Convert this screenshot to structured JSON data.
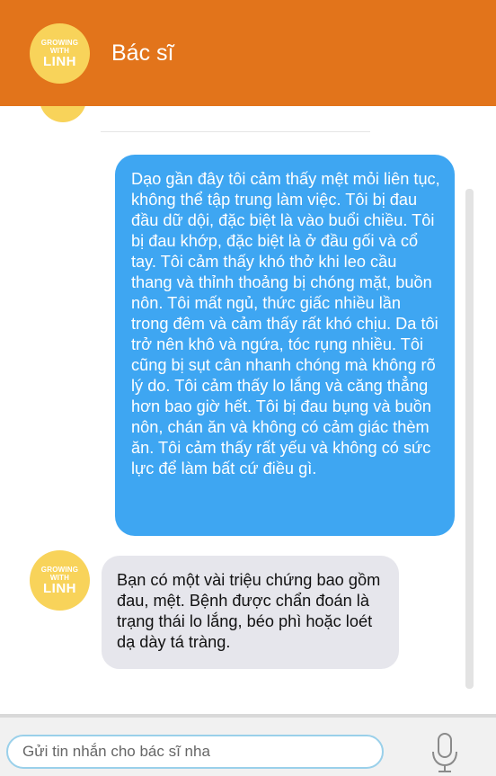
{
  "header": {
    "title": "Bác sĩ",
    "background_color": "#e2741b",
    "avatar": {
      "line1": "GROWING",
      "line2": "WITH",
      "line3": "LINH",
      "color": "#f8d35a"
    }
  },
  "messages": [
    {
      "sender": "user",
      "text": "Dạo gần đây tôi cảm thấy mệt mỏi liên tục, không thể tập trung làm việc. Tôi bị đau đầu dữ dội, đặc biệt là vào buổi chiều. Tôi bị đau khớp, đặc biệt là ở đầu gối và cổ tay. Tôi cảm thấy khó thở khi leo cầu thang và thỉnh thoảng bị chóng mặt, buồn nôn. Tôi mất ngủ, thức giấc nhiều lần trong đêm và cảm thấy rất khó chịu. Da tôi trở nên khô và ngứa, tóc rụng nhiều. Tôi cũng bị sụt cân nhanh chóng mà không rõ lý do. Tôi cảm thấy lo lắng và căng thẳng hơn bao giờ hết. Tôi bị đau bụng và buồn nôn, chán ăn và không có cảm giác thèm ăn. Tôi cảm thấy rất yếu và không có sức lực để làm bất cứ điều gì.",
      "bubble_color": "#3ea6f2"
    },
    {
      "sender": "bot",
      "avatar": {
        "line1": "GROWING",
        "line2": "WITH",
        "line3": "LINH"
      },
      "text": "Bạn có một vài triệu chứng bao gồm đau, mệt. Bệnh được chẩn đoán là trạng thái lo lắng, béo phì hoặc loét dạ dày tá tràng.",
      "bubble_color": "#e6e6ec"
    }
  ],
  "composer": {
    "placeholder": "Gửi tin nhắn cho bác sĩ nha",
    "value": "",
    "mic_icon": "microphone-icon"
  }
}
